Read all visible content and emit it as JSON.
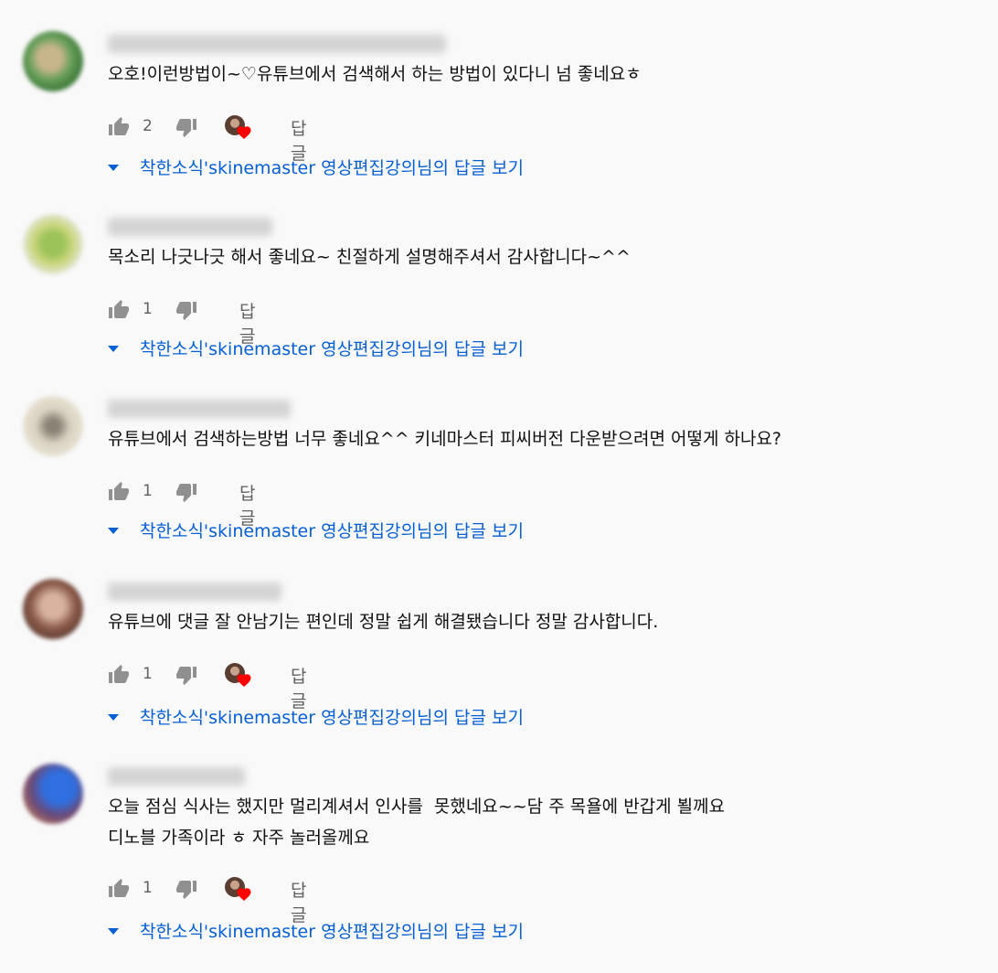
{
  "reply_label": "답글",
  "view_replies": "착한소식'skinemaster 영상편집강의님의 답글 보기",
  "comments": [
    {
      "text": "오호!이런방법이~♡유튜브에서 검색해서 하는 방법이 있다니 넘 좋네요ㅎ",
      "likes": "2",
      "hearted": true
    },
    {
      "text": "목소리 나긋나긋 해서 좋네요~ 친절하게 설명해주셔서 감사합니다~^^",
      "likes": "1",
      "hearted": false
    },
    {
      "text": "유튜브에서 검색하는방법 너무 좋네요^^ 키네마스터 피씨버전 다운받으려면 어떻게 하나요?",
      "likes": "1",
      "hearted": false
    },
    {
      "text": "유튜브에 댓글 잘 안남기는 편인데 정말 쉽게 해결됐습니다 정말 감사합니다.",
      "likes": "1",
      "hearted": true
    },
    {
      "text": "오늘 점심 식사는 했지만 멀리계셔서 인사를  못했네요~~담 주 목욜에 반갑게 뵐께요\n디노블 가족이라 ㅎ 자주 놀러올께요",
      "likes": "1",
      "hearted": true
    }
  ],
  "colors": {
    "link": "#065fd4",
    "heart": "#ff0000",
    "meta": "#606060"
  }
}
